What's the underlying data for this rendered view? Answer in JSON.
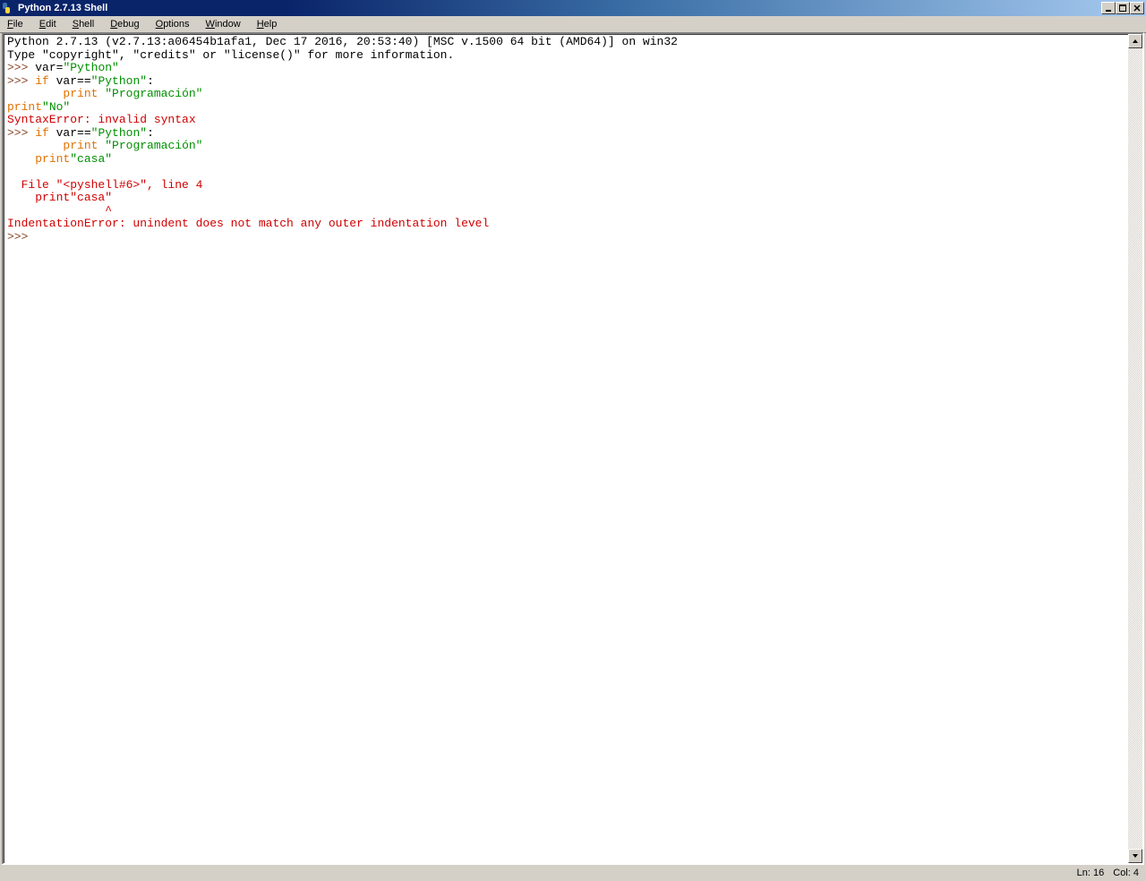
{
  "title": "Python 2.7.13 Shell",
  "menus": {
    "file": {
      "accel": "F",
      "rest": "ile"
    },
    "edit": {
      "accel": "E",
      "rest": "dit"
    },
    "shell": {
      "accel": "S",
      "rest": "hell"
    },
    "debug": {
      "accel": "D",
      "rest": "ebug"
    },
    "options": {
      "accel": "O",
      "rest": "ptions"
    },
    "window": {
      "accel": "W",
      "rest": "indow"
    },
    "help": {
      "accel": "H",
      "rest": "elp"
    }
  },
  "shell": {
    "banner1": "Python 2.7.13 (v2.7.13:a06454b1afa1, Dec 17 2016, 20:53:40) [MSC v.1500 64 bit (AMD64)] on win32",
    "banner2": "Type \"copyright\", \"credits\" or \"license()\" for more information.",
    "prompt": ">>> ",
    "line1_pre": "var=",
    "line1_str": "\"Python\"",
    "line2_kw": "if",
    "line2_mid": " var==",
    "line2_str": "\"Python\"",
    "line2_colon": ":",
    "line3_indent": "        ",
    "line3_kw": "print",
    "line3_sp": " ",
    "line3_str": "\"Programación\"",
    "line4_kw": "print",
    "line4_str": "\"No\"",
    "line5_err": "SyntaxError: invalid syntax",
    "line6_kw": "if",
    "line6_mid": " var==",
    "line6_str": "\"Python\"",
    "line6_colon": ":",
    "line7_indent": "        ",
    "line7_kw": "print",
    "line7_sp": " ",
    "line7_str": "\"Programación\"",
    "line8_indent": "    ",
    "line8_kw": "print",
    "line8_str": "\"casa\"",
    "line9_blank": "    ",
    "line10_err": "  File \"<pyshell#6>\", line 4",
    "line11_err": "    print\"casa\"",
    "line12_err": "              ^",
    "line13_err": "IndentationError: unindent does not match any outer indentation level",
    "line14_prompt": ">>> "
  },
  "status": {
    "ln": "Ln: 16",
    "col": "Col: 4"
  }
}
